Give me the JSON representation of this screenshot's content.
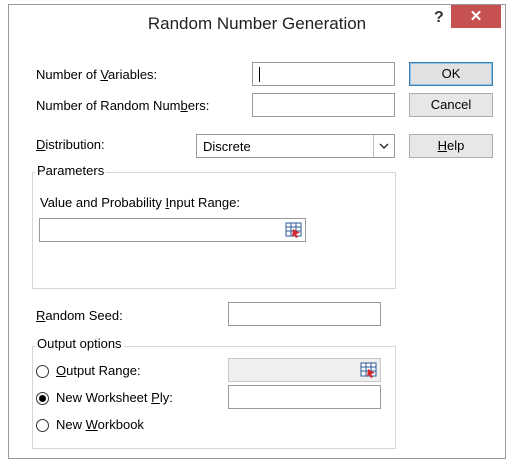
{
  "dialog": {
    "title": "Random Number Generation",
    "help_glyph": "?",
    "close_glyph": "✕"
  },
  "fields": {
    "num_variables": {
      "label_pre": "Number of ",
      "label_key": "V",
      "label_post": "ariables:",
      "value": ""
    },
    "num_random": {
      "label_pre": "Number of Random Num",
      "label_key": "b",
      "label_post": "ers:",
      "value": ""
    },
    "distribution": {
      "label_pre": "",
      "label_key": "D",
      "label_post": "istribution:",
      "value": "Discrete",
      "arrow": "⌄"
    },
    "random_seed": {
      "label_pre": "",
      "label_key": "R",
      "label_post": "andom Seed:",
      "value": ""
    }
  },
  "parameters": {
    "group_title": "Parameters",
    "input_range": {
      "label_pre": "Value and Probability ",
      "label_key": "I",
      "label_post": "nput Range:",
      "value": ""
    }
  },
  "output": {
    "group_title": "Output options",
    "options": [
      {
        "label_pre": "",
        "label_key": "O",
        "label_post": "utput Range:",
        "checked": false
      },
      {
        "label_pre": "New Worksheet ",
        "label_key": "P",
        "label_post": "ly:",
        "checked": true
      },
      {
        "label_pre": "New ",
        "label_key": "W",
        "label_post": "orkbook",
        "checked": false
      }
    ]
  },
  "buttons": {
    "ok": "OK",
    "cancel": "Cancel",
    "help_pre": "",
    "help_key": "H",
    "help_post": "elp"
  },
  "colors": {
    "close_button": "#c75050",
    "default_button_border": "#3c7fb1"
  },
  "icons": {
    "range_selector": "collapse-dialog-icon"
  }
}
